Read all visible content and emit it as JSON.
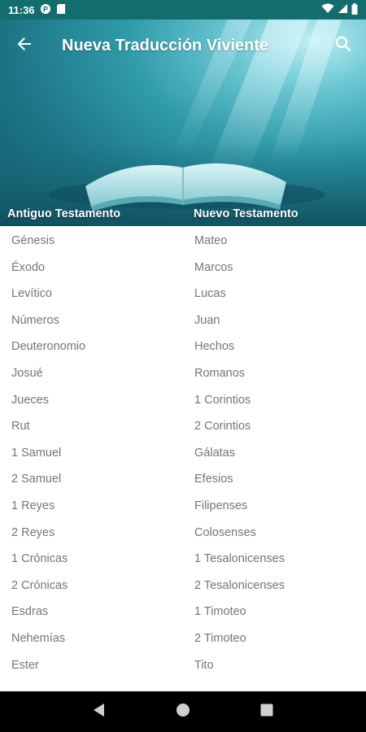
{
  "status_bar": {
    "time": "11:36"
  },
  "app_bar": {
    "title": "Nueva Traducción Viviente"
  },
  "sections": {
    "old_testament_label": "Antiguo Testamento",
    "new_testament_label": "Nuevo Testamento"
  },
  "old_testament": [
    "Génesis",
    "Éxodo",
    "Levítico",
    "Números",
    "Deuteronomio",
    "Josué",
    "Jueces",
    "Rut",
    "1 Samuel",
    "2 Samuel",
    "1 Reyes",
    "2 Reyes",
    "1 Crónicas",
    "2 Crónicas",
    "Esdras",
    "Nehemías",
    "Ester"
  ],
  "new_testament": [
    "Mateo",
    "Marcos",
    "Lucas",
    "Juan",
    "Hechos",
    "Romanos",
    "1 Corintios",
    "2 Corintios",
    "Gálatas",
    "Efesios",
    "Filipenses",
    "Colosenses",
    "1 Tesalonicenses",
    "2 Tesalonicenses",
    "1 Timoteo",
    "2 Timoteo",
    "Tito"
  ],
  "colors": {
    "status_bar": "#136d6f",
    "book_text": "#757575",
    "header_text": "#ffffff"
  }
}
